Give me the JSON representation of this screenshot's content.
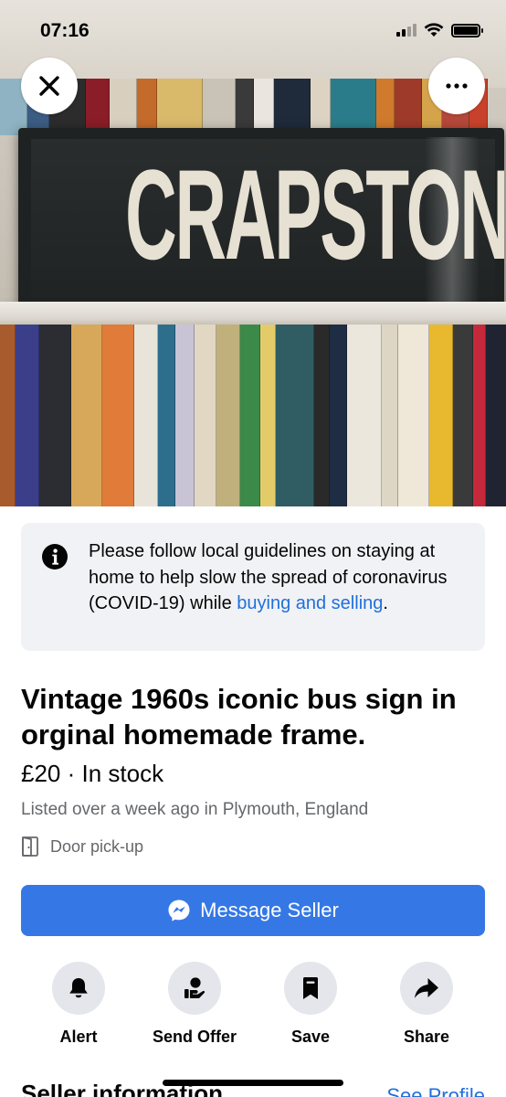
{
  "status_bar": {
    "time": "07:16",
    "icons": [
      "cellular-signal-icon",
      "wifi-icon",
      "battery-icon"
    ]
  },
  "hero": {
    "sign_text": "CRAPSTONE",
    "top_buttons": [
      "close-icon",
      "more-icon"
    ]
  },
  "notice": {
    "text": "Please follow local guidelines on staying at home to help slow the spread of coronavirus (COVID-19) while ",
    "link": "buying and selling",
    "end": ".",
    "icon": "info-icon"
  },
  "listing": {
    "title": "Vintage 1960s iconic bus sign in orginal homemade frame.",
    "price": "£20",
    "separator": " · ",
    "availability": "In stock",
    "listed": "Listed over a week ago in Plymouth, England",
    "pickup": "Door pick-up"
  },
  "primary_action": {
    "label": "Message Seller",
    "icon": "messenger-icon"
  },
  "actions": [
    {
      "label": "Alert",
      "icon": "bell-icon"
    },
    {
      "label": "Send Offer",
      "icon": "offer-hand-icon"
    },
    {
      "label": "Save",
      "icon": "bookmark-icon"
    },
    {
      "label": "Share",
      "icon": "share-arrow-icon"
    }
  ],
  "seller": {
    "heading": "Seller information",
    "link": "See Profile"
  },
  "colors": {
    "accent": "#3578e5",
    "link": "#216fdb",
    "secondary_text": "#65676b",
    "notice_bg": "#f0f2f5",
    "action_circle_bg": "#e4e6eb"
  }
}
